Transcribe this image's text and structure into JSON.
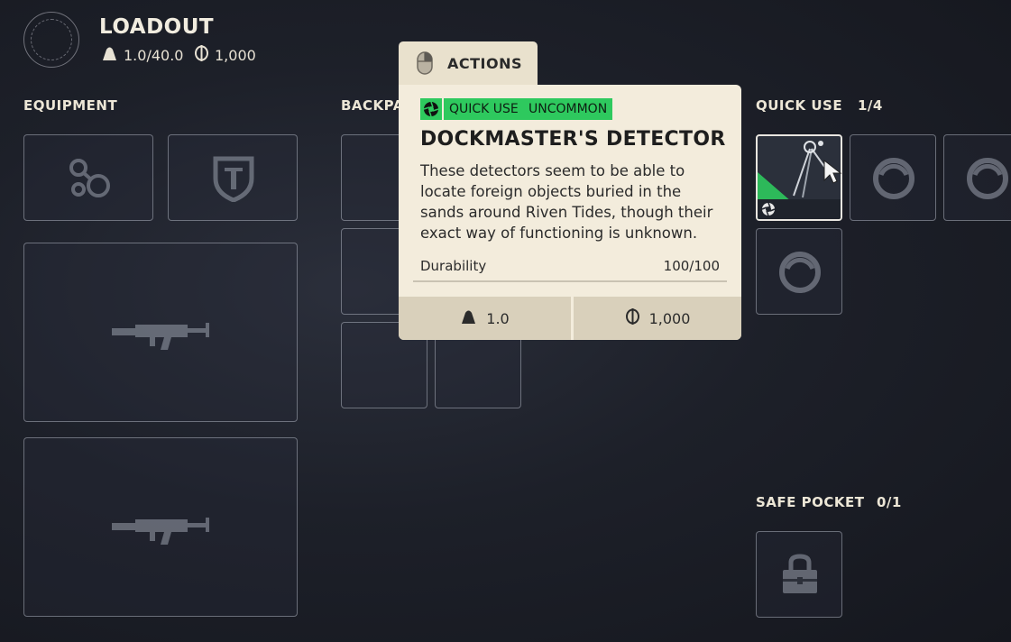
{
  "loadout": {
    "title": "LOADOUT",
    "weight": "1.0/40.0",
    "currency": "1,000"
  },
  "sections": {
    "equipment": "EQUIPMENT",
    "backpack": "BACKPA",
    "quick_use": "QUICK USE",
    "quick_use_count": "1/4",
    "safe_pocket": "SAFE POCKET",
    "safe_pocket_count": "0/1"
  },
  "tooltip": {
    "actions_label": "ACTIONS",
    "tags": [
      "QUICK USE",
      "UNCOMMON"
    ],
    "name": "DOCKMASTER'S DETECTOR",
    "description": "These detectors seem to be able to locate foreign objects buried in the sands around Riven Tides, though their exact way of functioning is unknown.",
    "durability_label": "Durability",
    "durability_value": "100/100",
    "weight": "1.0",
    "value": "1,000"
  },
  "icons": [
    "mouse-icon",
    "weight-icon",
    "coin-icon",
    "aperture-icon",
    "attachment-icon",
    "shield-icon",
    "rifle-icon",
    "ring-icon",
    "lock-icon",
    "cursor-icon"
  ],
  "colors": {
    "rarity_uncommon": "#2ec95e",
    "tooltip_bg": "#f3ecdc",
    "accent_purple": "#8a3fd1"
  }
}
